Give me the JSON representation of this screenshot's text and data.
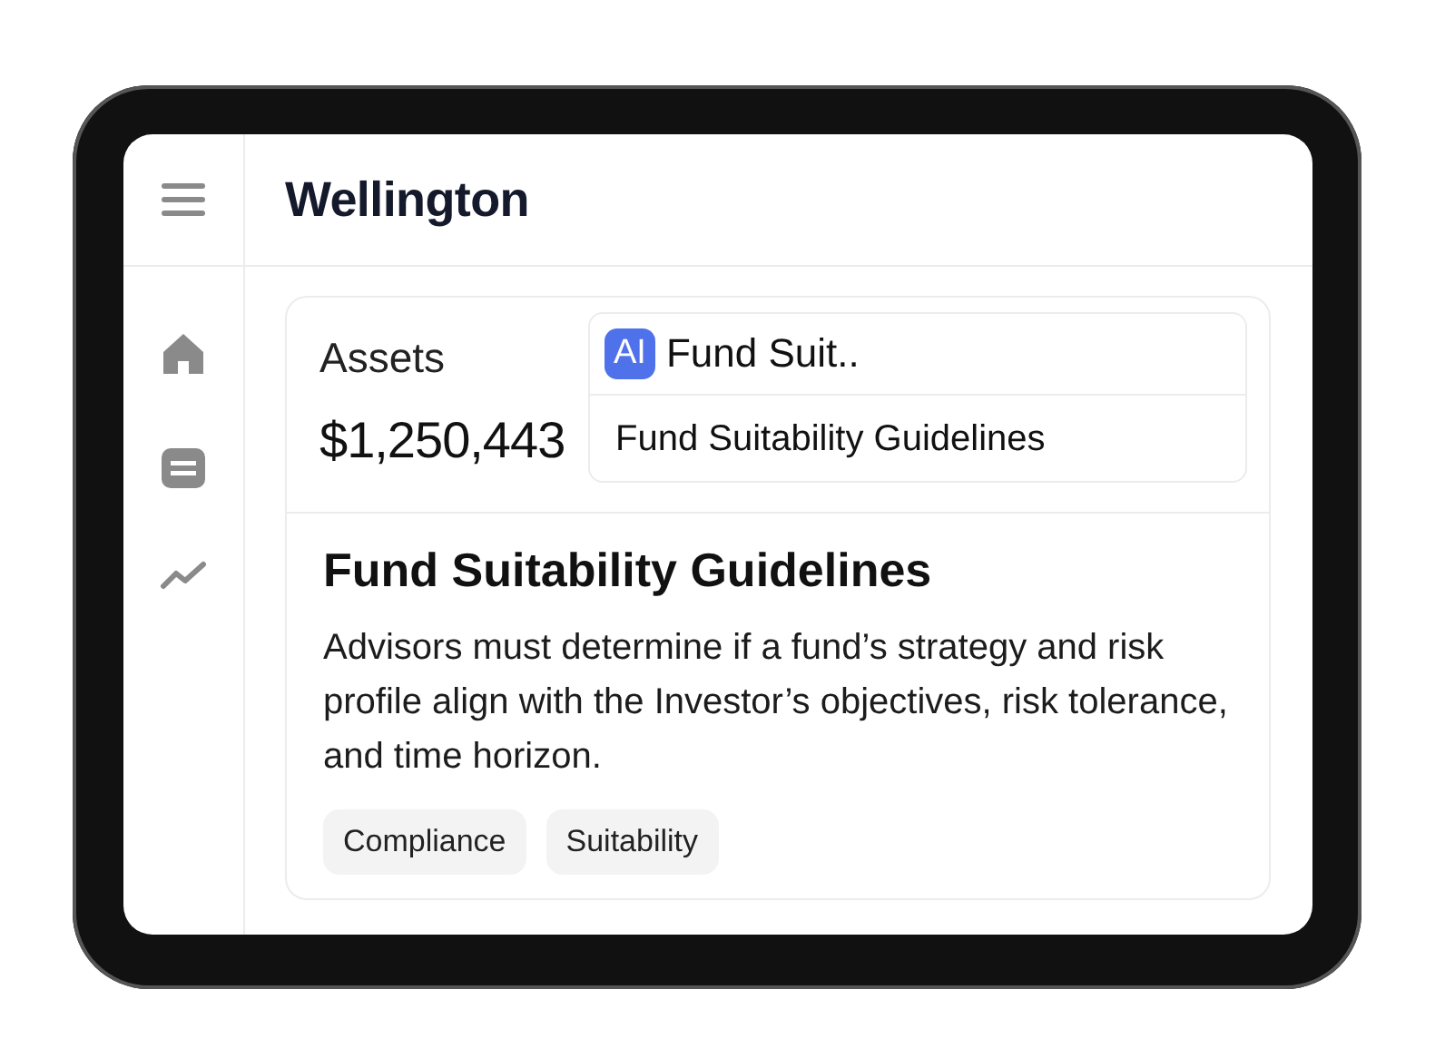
{
  "app": {
    "title": "Wellington"
  },
  "summary": {
    "label": "Assets",
    "value": "$1,250,443"
  },
  "suggestion": {
    "badge": "AI",
    "query": "Fund Suit..",
    "result": "Fund Suitability Guidelines"
  },
  "article": {
    "title": "Fund Suitability Guidelines",
    "body": "Advisors must determine if a fund’s strategy and risk profile align with the Investor’s objectives, risk tolerance, and time horizon.",
    "tags": [
      "Compliance",
      "Suitability"
    ]
  }
}
